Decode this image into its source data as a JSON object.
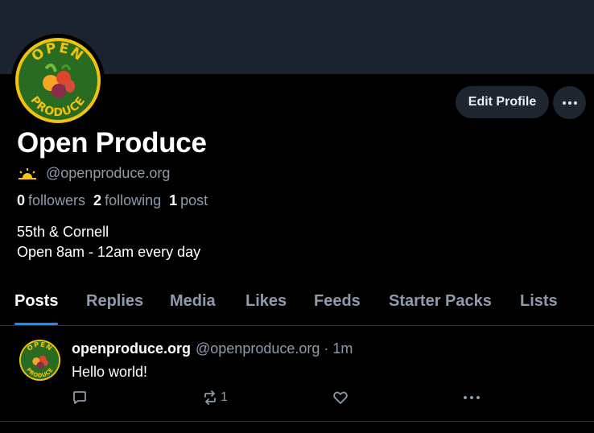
{
  "profile": {
    "display_name": "Open Produce",
    "handle": "@openproduce.org",
    "avatar_logo_text": "OPEN PRODUCE",
    "edit_label": "Edit Profile",
    "stats": {
      "followers_count": "0",
      "followers_label": "followers",
      "following_count": "2",
      "following_label": "following",
      "posts_count": "1",
      "posts_label": "post"
    },
    "bio_line1": "55th & Cornell",
    "bio_line2": "Open 8am - 12am every day"
  },
  "tabs": [
    "Posts",
    "Replies",
    "Media",
    "Likes",
    "Feeds",
    "Starter Packs",
    "Lists"
  ],
  "post": {
    "author": "openproduce.org",
    "meta": "@openproduce.org · 1m",
    "text": "Hello world!",
    "repost_count": "1"
  },
  "colors": {
    "accent": "#1d8cf5",
    "muted": "#8d9bac",
    "banner": "#1c2330",
    "logo_green": "#2a6b22",
    "logo_yellow": "#f2c20e"
  },
  "icons": [
    "sunrise-icon",
    "ellipsis-icon",
    "reply-icon",
    "repost-icon",
    "like-icon"
  ]
}
